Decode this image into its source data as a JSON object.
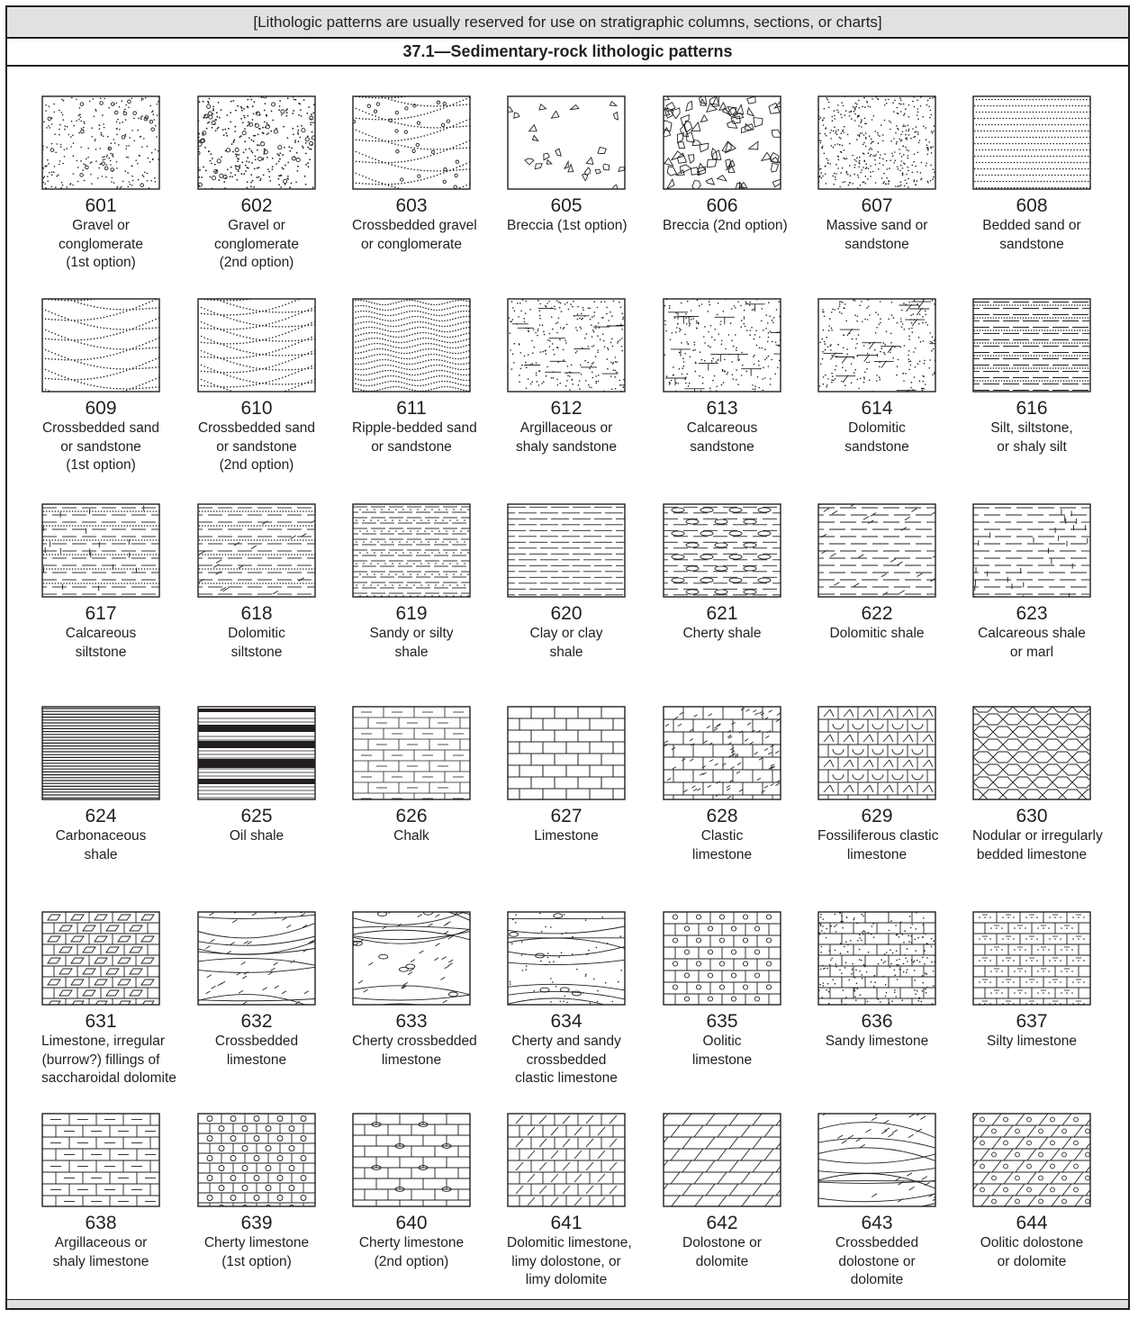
{
  "header": {
    "note": "[Lithologic patterns are usually reserved for use on stratigraphic columns, sections, or charts]",
    "title": "37.1—Sedimentary-rock lithologic patterns"
  },
  "patterns": [
    {
      "code": "601",
      "lines": [
        "Gravel or",
        "conglomerate",
        "(1st option)"
      ],
      "pattern": "gravel-1"
    },
    {
      "code": "602",
      "lines": [
        "Gravel or",
        "conglomerate",
        "(2nd option)"
      ],
      "pattern": "gravel-2"
    },
    {
      "code": "603",
      "lines": [
        "Crossbedded gravel",
        "or conglomerate"
      ],
      "pattern": "crossbedded-gravel"
    },
    {
      "code": "605",
      "lines": [
        "Breccia (1st option)"
      ],
      "pattern": "breccia-1"
    },
    {
      "code": "606",
      "lines": [
        "Breccia (2nd option)"
      ],
      "pattern": "breccia-2"
    },
    {
      "code": "607",
      "lines": [
        "Massive sand or",
        "sandstone"
      ],
      "pattern": "massive-sand"
    },
    {
      "code": "608",
      "lines": [
        "Bedded sand or",
        "sandstone"
      ],
      "pattern": "bedded-sand"
    },
    {
      "code": "609",
      "lines": [
        "Crossbedded sand",
        "or sandstone",
        "(1st option)"
      ],
      "pattern": "crossbedded-sand-1"
    },
    {
      "code": "610",
      "lines": [
        "Crossbedded sand",
        "or sandstone",
        "(2nd option)"
      ],
      "pattern": "crossbedded-sand-2"
    },
    {
      "code": "611",
      "lines": [
        "Ripple-bedded sand",
        "or sandstone"
      ],
      "pattern": "ripple-sand"
    },
    {
      "code": "612",
      "lines": [
        "Argillaceous or",
        "shaly sandstone"
      ],
      "pattern": "argillaceous-sandstone"
    },
    {
      "code": "613",
      "lines": [
        "Calcareous",
        "sandstone"
      ],
      "pattern": "calcareous-sandstone"
    },
    {
      "code": "614",
      "lines": [
        "Dolomitic",
        "sandstone"
      ],
      "pattern": "dolomitic-sandstone"
    },
    {
      "code": "616",
      "lines": [
        "Silt, siltstone,",
        "or shaly silt"
      ],
      "pattern": "silt"
    },
    {
      "code": "617",
      "lines": [
        "Calcareous",
        "siltstone"
      ],
      "pattern": "calcareous-siltstone"
    },
    {
      "code": "618",
      "lines": [
        "Dolomitic",
        "siltstone"
      ],
      "pattern": "dolomitic-siltstone"
    },
    {
      "code": "619",
      "lines": [
        "Sandy or silty",
        "shale"
      ],
      "pattern": "sandy-shale"
    },
    {
      "code": "620",
      "lines": [
        "Clay or clay",
        "shale"
      ],
      "pattern": "clay-shale"
    },
    {
      "code": "621",
      "lines": [
        "Cherty shale"
      ],
      "pattern": "cherty-shale"
    },
    {
      "code": "622",
      "lines": [
        "Dolomitic shale"
      ],
      "pattern": "dolomitic-shale"
    },
    {
      "code": "623",
      "lines": [
        "Calcareous shale",
        "or marl"
      ],
      "pattern": "calcareous-shale"
    },
    {
      "code": "624",
      "lines": [
        "Carbonaceous",
        "shale"
      ],
      "pattern": "carbonaceous-shale"
    },
    {
      "code": "625",
      "lines": [
        "Oil shale"
      ],
      "pattern": "oil-shale"
    },
    {
      "code": "626",
      "lines": [
        "Chalk"
      ],
      "pattern": "chalk"
    },
    {
      "code": "627",
      "lines": [
        "Limestone"
      ],
      "pattern": "limestone"
    },
    {
      "code": "628",
      "lines": [
        "Clastic",
        "limestone"
      ],
      "pattern": "clastic-limestone"
    },
    {
      "code": "629",
      "lines": [
        "Fossiliferous clastic",
        "limestone"
      ],
      "pattern": "fossiliferous-limestone"
    },
    {
      "code": "630",
      "lines": [
        "Nodular or irregularly",
        "bedded limestone"
      ],
      "pattern": "nodular-limestone"
    },
    {
      "code": "631",
      "lines": [
        "Limestone, irregular",
        "(burrow?) fillings of",
        "saccharoidal dolomite"
      ],
      "pattern": "burrow-limestone"
    },
    {
      "code": "632",
      "lines": [
        "Crossbedded",
        "limestone"
      ],
      "pattern": "crossbedded-limestone"
    },
    {
      "code": "633",
      "lines": [
        "Cherty crossbedded",
        "limestone"
      ],
      "pattern": "cherty-crossbedded-limestone"
    },
    {
      "code": "634",
      "lines": [
        "Cherty and sandy",
        "crossbedded",
        "clastic limestone"
      ],
      "pattern": "cherty-sandy-limestone"
    },
    {
      "code": "635",
      "lines": [
        "Oolitic",
        "limestone"
      ],
      "pattern": "oolitic-limestone"
    },
    {
      "code": "636",
      "lines": [
        "Sandy limestone"
      ],
      "pattern": "sandy-limestone"
    },
    {
      "code": "637",
      "lines": [
        "Silty limestone"
      ],
      "pattern": "silty-limestone"
    },
    {
      "code": "638",
      "lines": [
        "Argillaceous or",
        "shaly limestone"
      ],
      "pattern": "argillaceous-limestone"
    },
    {
      "code": "639",
      "lines": [
        "Cherty limestone",
        "(1st option)"
      ],
      "pattern": "cherty-limestone-1"
    },
    {
      "code": "640",
      "lines": [
        "Cherty limestone",
        "(2nd option)"
      ],
      "pattern": "cherty-limestone-2"
    },
    {
      "code": "641",
      "lines": [
        "Dolomitic limestone,",
        "limy dolostone, or",
        "limy dolomite"
      ],
      "pattern": "dolomitic-limestone"
    },
    {
      "code": "642",
      "lines": [
        "Dolostone or",
        "dolomite"
      ],
      "pattern": "dolostone"
    },
    {
      "code": "643",
      "lines": [
        "Crossbedded",
        "dolostone or",
        "dolomite"
      ],
      "pattern": "crossbedded-dolostone"
    },
    {
      "code": "644",
      "lines": [
        "Oolitic dolostone",
        "or dolomite"
      ],
      "pattern": "oolitic-dolostone"
    }
  ]
}
